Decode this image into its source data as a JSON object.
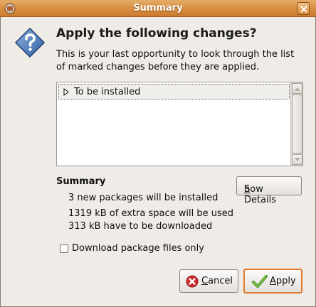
{
  "window": {
    "title": "Summary",
    "icon": "package-manager-icon",
    "close_icon": "close-icon",
    "accent_color": "#d98f42"
  },
  "dialog": {
    "icon": "question-icon",
    "heading": "Apply the following changes?",
    "description": "This is your last opportunity to look through the list of marked changes before they are applied."
  },
  "changes_tree": {
    "rows": [
      {
        "label": "To be installed",
        "expander_icon": "triangle-right-icon"
      }
    ]
  },
  "summary": {
    "title": "Summary",
    "lines": [
      "3 new packages will be installed",
      "1319 kB of extra space will be used",
      "313 kB have to be downloaded"
    ]
  },
  "buttons": {
    "show_details": {
      "mnemonic": "S",
      "rest": "how Details"
    },
    "cancel": {
      "mnemonic": "C",
      "rest": "ancel",
      "icon": "cancel-icon"
    },
    "apply": {
      "mnemonic": "A",
      "rest": "pply",
      "icon": "checkmark-icon",
      "highlight_color": "#e07a2c"
    }
  },
  "options": {
    "download_only": {
      "label": "Download package files only",
      "checked": false
    }
  }
}
